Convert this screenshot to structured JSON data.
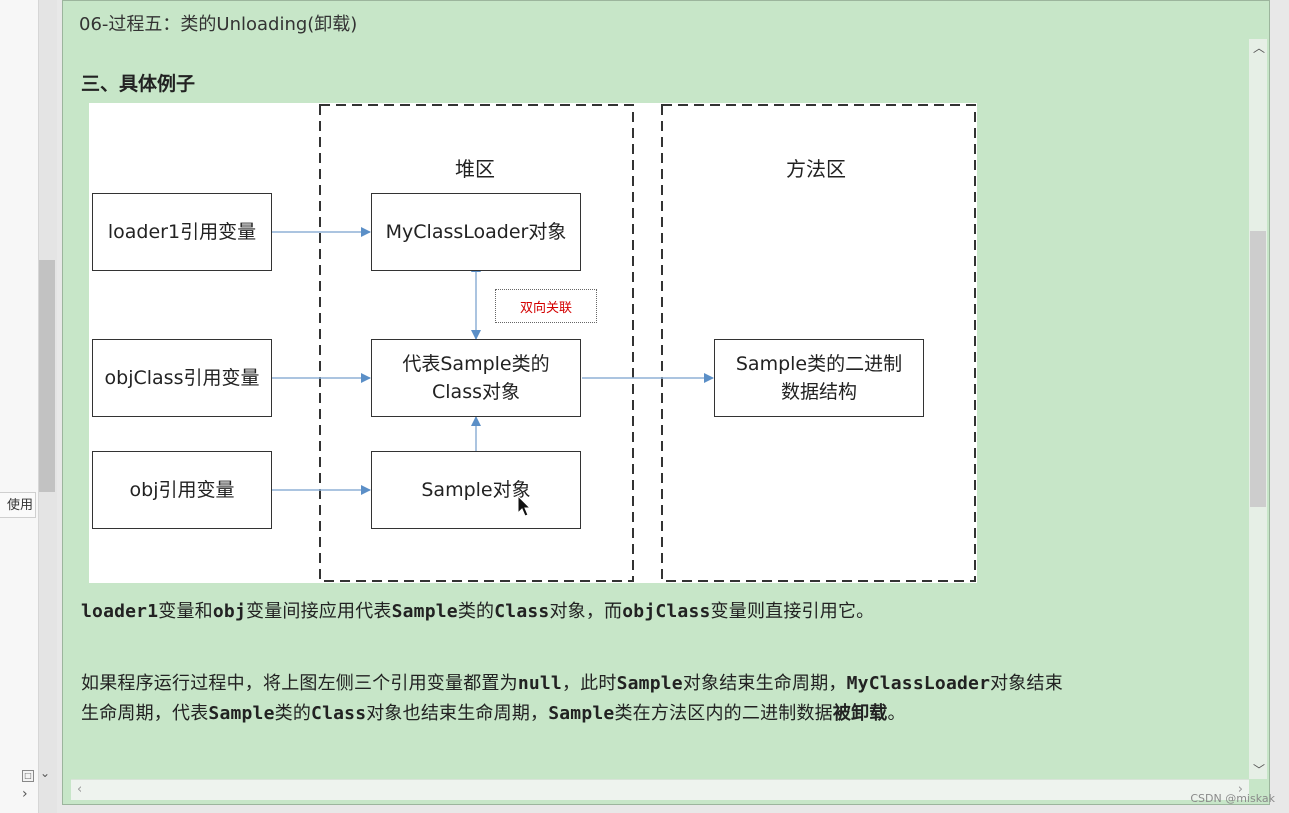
{
  "window": {
    "title": "06-过程五：类的Unloading(卸载)",
    "heading": "三、具体例子"
  },
  "sidebar": {
    "label": "使用"
  },
  "diagram": {
    "heap_title": "堆区",
    "method_title": "方法区",
    "left_boxes": [
      "loader1引用变量",
      "objClass引用变量",
      "obj引用变量"
    ],
    "heap_boxes": {
      "loader_obj": "MyClassLoader对象",
      "class_obj_line1": "代表Sample类的",
      "class_obj_line2": "Class对象",
      "sample_obj": "Sample对象"
    },
    "method_box_line1": "Sample类的二进制",
    "method_box_line2": "数据结构",
    "bidirectional_label": "双向关联"
  },
  "paragraphs": {
    "p1": [
      {
        "t": "loader1",
        "code": true
      },
      {
        "t": "变量和",
        "code": false
      },
      {
        "t": "obj",
        "code": true
      },
      {
        "t": "变量间接应用代表",
        "code": false
      },
      {
        "t": "Sample",
        "code": true
      },
      {
        "t": "类的",
        "code": false
      },
      {
        "t": "Class",
        "code": true
      },
      {
        "t": "对象，而",
        "code": false
      },
      {
        "t": "objClass",
        "code": true
      },
      {
        "t": "变量则直接引用它。",
        "code": false
      }
    ],
    "p2_line1": [
      {
        "t": "如果程序运行过程中，将上图左侧三个引用变量都置为",
        "code": false
      },
      {
        "t": "null",
        "code": true
      },
      {
        "t": "，此时",
        "code": false
      },
      {
        "t": "Sample",
        "code": true
      },
      {
        "t": "对象结束生命周期，",
        "code": false
      },
      {
        "t": "MyClassLoader",
        "code": true
      },
      {
        "t": "对象结束",
        "code": false
      }
    ],
    "p2_line2": [
      {
        "t": "生命周期，代表",
        "code": false
      },
      {
        "t": "Sample",
        "code": true
      },
      {
        "t": "类的",
        "code": false
      },
      {
        "t": "Class",
        "code": true
      },
      {
        "t": "对象也结束生命周期，",
        "code": false
      },
      {
        "t": "Sample",
        "code": true
      },
      {
        "t": "类在方法区内的二进制数据",
        "code": false
      },
      {
        "t": "被卸载",
        "code": false,
        "bold": true
      },
      {
        "t": "。",
        "code": false
      }
    ]
  },
  "watermark": "CSDN @miskak"
}
